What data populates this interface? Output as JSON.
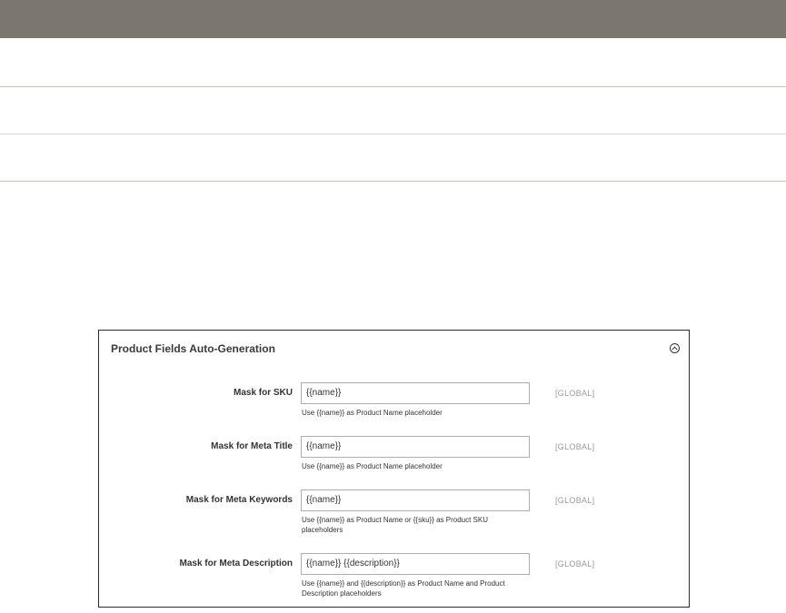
{
  "panel": {
    "title": "Product Fields Auto-Generation",
    "collapse_icon": "chevron-up-circle-icon"
  },
  "fields": [
    {
      "label": "Mask for SKU",
      "value": "{{name}}",
      "scope": "[GLOBAL]",
      "note": "Use {{name}} as Product Name placeholder"
    },
    {
      "label": "Mask for Meta Title",
      "value": "{{name}}",
      "scope": "[GLOBAL]",
      "note": "Use {{name}} as Product Name placeholder"
    },
    {
      "label": "Mask for Meta Keywords",
      "value": "{{name}}",
      "scope": "[GLOBAL]",
      "note": "Use {{name}} as Product Name or {{sku}} as Product SKU placeholders"
    },
    {
      "label": "Mask for Meta Description",
      "value": "{{name}} {{description}}",
      "scope": "[GLOBAL]",
      "note": "Use {{name}} and {{description}} as Product Name and Product Description placeholders"
    }
  ],
  "colors": {
    "topbar": "#7b776e",
    "divider_accent": "#cfbfb3",
    "divider_gray": "#d6d6d6"
  }
}
